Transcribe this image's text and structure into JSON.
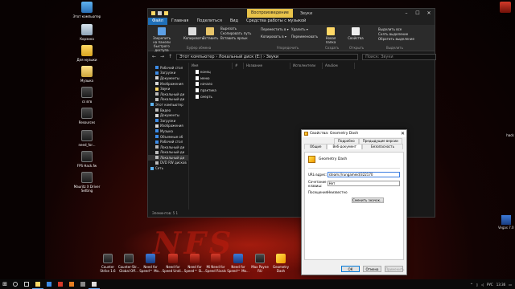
{
  "desktop": {
    "left_icons": [
      {
        "label": "Этот компьютер",
        "icon": "computer-icon",
        "kind": "pc"
      },
      {
        "label": "Корзина",
        "icon": "recycle-bin-icon",
        "kind": "bin"
      },
      {
        "label": "Для музыки",
        "icon": "folder-icon",
        "kind": "folder"
      },
      {
        "label": "Музыка",
        "icon": "music-folder-icon",
        "kind": "music"
      },
      {
        "label": "cs вгв",
        "icon": "file-icon",
        "kind": "app"
      },
      {
        "label": "Resources",
        "icon": "folder-icon",
        "kind": "app"
      },
      {
        "label": "need_for...",
        "icon": "file-icon",
        "kind": "app"
      },
      {
        "label": "FPS Hack.fw",
        "icon": "file-icon",
        "kind": "app"
      },
      {
        "label": "Mauritz X Driver Setting",
        "icon": "driver-icon",
        "kind": "app"
      }
    ],
    "bottom_icons": [
      {
        "label": "Counter Strike 1.6",
        "icon": "counter-strike-icon"
      },
      {
        "label": "Counter-Str... Global Off...",
        "icon": "counter-strike-go-icon"
      },
      {
        "label": "Need for Speed™ Mo...",
        "icon": "need-for-speed-icon"
      },
      {
        "label": "Need for Speed Undi...",
        "icon": "need-for-speed-icon"
      },
      {
        "label": "Need for Speed™ SL...",
        "icon": "need-for-speed-icon"
      },
      {
        "label": "Mi Need for Speed Rivals",
        "icon": "need-for-speed-icon"
      },
      {
        "label": "Need for Speed™ Mo...",
        "icon": "need-for-speed-icon"
      },
      {
        "label": "Max Payne RU",
        "icon": "max-payne-icon"
      },
      {
        "label": "Geometry Dash",
        "icon": "geometry-dash-icon"
      }
    ],
    "right_fragments": [
      "hack",
      "Vegas 7.0"
    ]
  },
  "explorer": {
    "title_context_tab": "Воспроизведение",
    "window_name": "Звуки",
    "tabs": [
      "Файл",
      "Главная",
      "Поделиться",
      "Вид",
      "Средства работы с музыкой"
    ],
    "ribbon": {
      "pin_label": "Закрепить на панели быстрого доступа",
      "copy_label": "Копировать",
      "paste_label": "Вставить",
      "cut_label": "Вырезать",
      "copy_path_label": "Скопировать путь",
      "paste_shortcut_label": "Вставить ярлык",
      "group_clipboard": "Буфер обмена",
      "move_label": "Переместить в ▾",
      "copy_to_label": "Копировать в ▾",
      "delete_label": "Удалить ▾",
      "rename_label": "Переименовать",
      "group_organize": "Упорядочить",
      "new_folder_label": "Новая папка",
      "group_create": "Создать",
      "properties_label": "Свойства",
      "group_open": "Открыть",
      "select_all_label": "Выделить все",
      "deselect_label": "Снять выделение",
      "invert_label": "Обратить выделение",
      "group_select": "Выделить"
    },
    "address": "Этот компьютер › Локальный диск (E:) › Звуки",
    "search_placeholder": "Поиск: Звуки",
    "sidebar": [
      {
        "label": "Рабочий стол",
        "color": "#3c8ce8"
      },
      {
        "label": "Загрузки",
        "color": "#3c8ce8"
      },
      {
        "label": "Документы",
        "color": "#d8d8d8"
      },
      {
        "label": "Изображения",
        "color": "#d8d8d8"
      },
      {
        "label": "Звуки",
        "color": "#ffd866"
      },
      {
        "label": "Локальный ди",
        "color": "#bbbbbb"
      },
      {
        "label": "Локальный ди",
        "color": "#bbbbbb"
      },
      {
        "label": "Этот компьютер",
        "color": "#5fb3f0"
      },
      {
        "label": "Видео",
        "color": "#bbbbbb"
      },
      {
        "label": "Документы",
        "color": "#d8d8d8"
      },
      {
        "label": "Загрузки",
        "color": "#3c8ce8"
      },
      {
        "label": "Изображения",
        "color": "#d8d8d8"
      },
      {
        "label": "Музыка",
        "color": "#3c8ce8"
      },
      {
        "label": "Объемные об",
        "color": "#3c8ce8"
      },
      {
        "label": "Рабочий стол",
        "color": "#3c8ce8"
      },
      {
        "label": "Локальный ди",
        "color": "#bbbbbb"
      },
      {
        "label": "Локальный ди",
        "color": "#bbbbbb"
      },
      {
        "label": "Локальный ди",
        "color": "#bbbbbb",
        "selected": true
      },
      {
        "label": "DVD RW дисков",
        "color": "#bbbbbb"
      },
      {
        "label": "Сеть",
        "color": "#5fb3f0"
      }
    ],
    "columns": [
      "Имя",
      "#",
      "Название",
      "Исполнители",
      "Альбом"
    ],
    "files": [
      "конец",
      "меню",
      "начало",
      "практика",
      "смерть"
    ],
    "status": "Элементов: 5   1"
  },
  "dialog": {
    "title": "Свойства: Geometry Dash",
    "tabs_back": [
      "Общие",
      "Веб-документ",
      "Безопасность"
    ],
    "tabs_front": [
      "Подробно",
      "Предыдущие версии"
    ],
    "active_tab": "Веб-документ",
    "file_name": "Geometry Dash",
    "url_label": "URL-адрес:",
    "url_value": "steam://rungameid/322170",
    "hotkey_label": "Сочетание клавиш:",
    "hotkey_value": "Нет",
    "visits_label": "Посещения:",
    "visits_value": "Неизвестно",
    "change_icon_button": "Сменить значок...",
    "ok_button": "ОК",
    "cancel_button": "Отмена",
    "apply_button": "Применить"
  },
  "taskbar": {
    "start_icon": "windows-icon",
    "lang": "РУС",
    "time": "13:36"
  }
}
